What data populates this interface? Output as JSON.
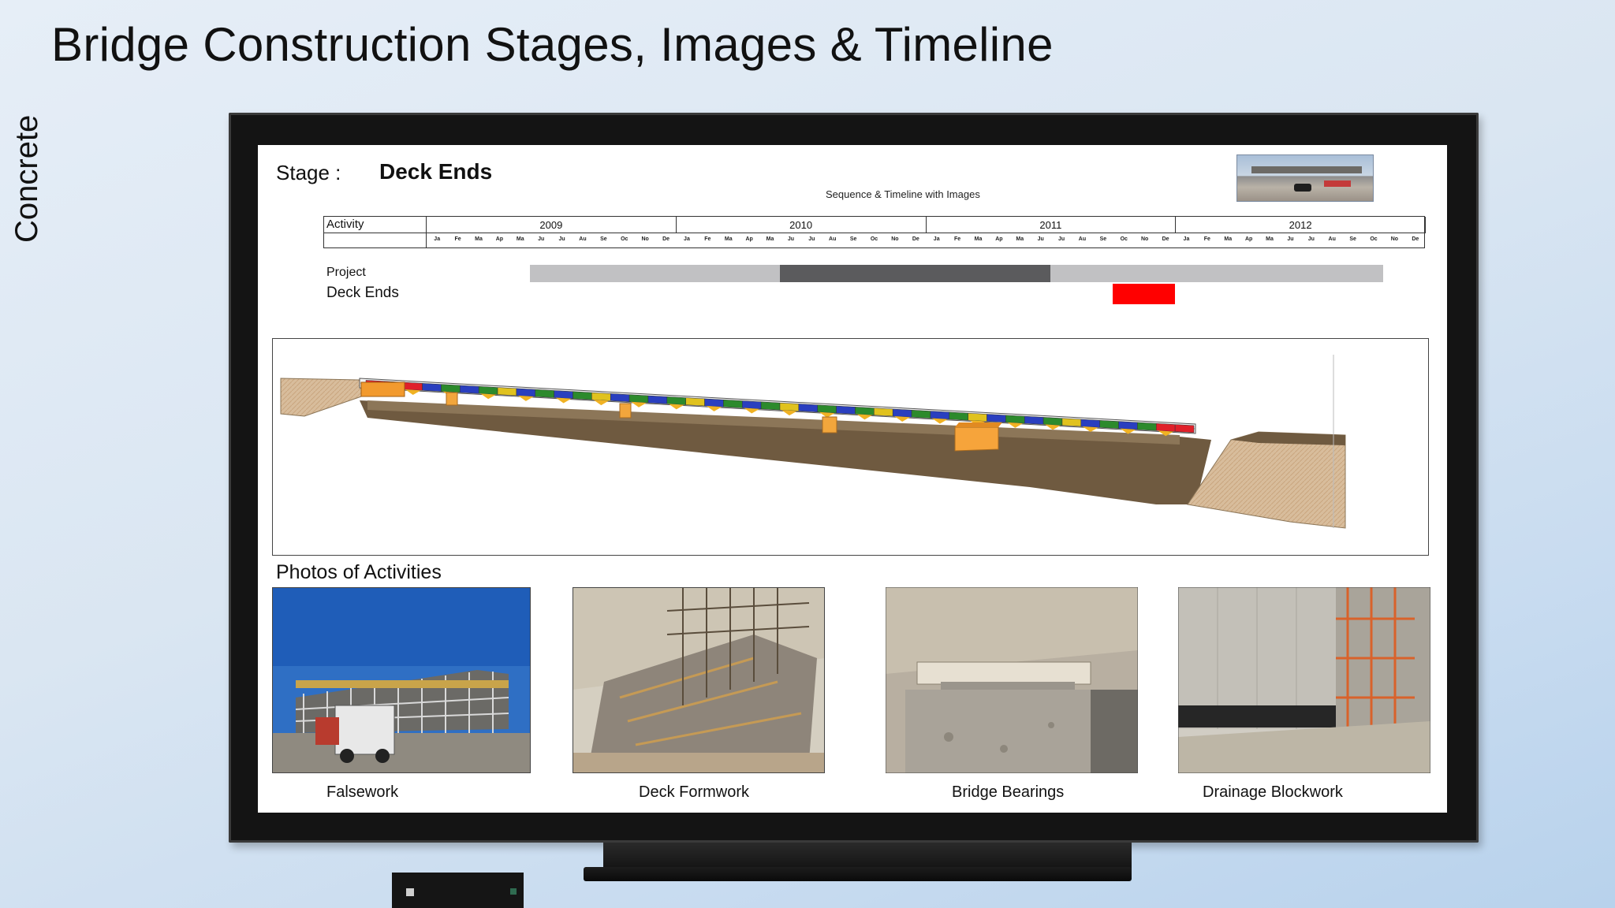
{
  "slide": {
    "title": "Bridge Construction Stages, Images & Timeline",
    "side_label": "Concrete"
  },
  "stage": {
    "label": "Stage :",
    "name": "Deck Ends",
    "subtitle": "Sequence & Timeline with Images"
  },
  "gantt": {
    "activity_header": "Activity",
    "years": [
      "2009",
      "2010",
      "2011",
      "2012"
    ],
    "months": [
      "Ja",
      "Fe",
      "Ma",
      "Ap",
      "Ma",
      "Ju",
      "Ju",
      "Au",
      "Se",
      "Oc",
      "No",
      "De"
    ],
    "rows": [
      {
        "label": "Project",
        "start": "2009-06",
        "end": "2012-11",
        "highlight_start": "2010-06",
        "highlight_end": "2011-07",
        "color": "#c1c1c3",
        "highlight_color": "#5b5b5d"
      },
      {
        "label": "Deck Ends",
        "start": "2011-10",
        "end": "2012-01",
        "color": "#ff0000"
      }
    ]
  },
  "photos": {
    "heading": "Photos of Activities",
    "items": [
      {
        "caption": "Falsework"
      },
      {
        "caption": "Deck Formwork"
      },
      {
        "caption": "Bridge Bearings"
      },
      {
        "caption": "Drainage Blockwork"
      }
    ]
  }
}
